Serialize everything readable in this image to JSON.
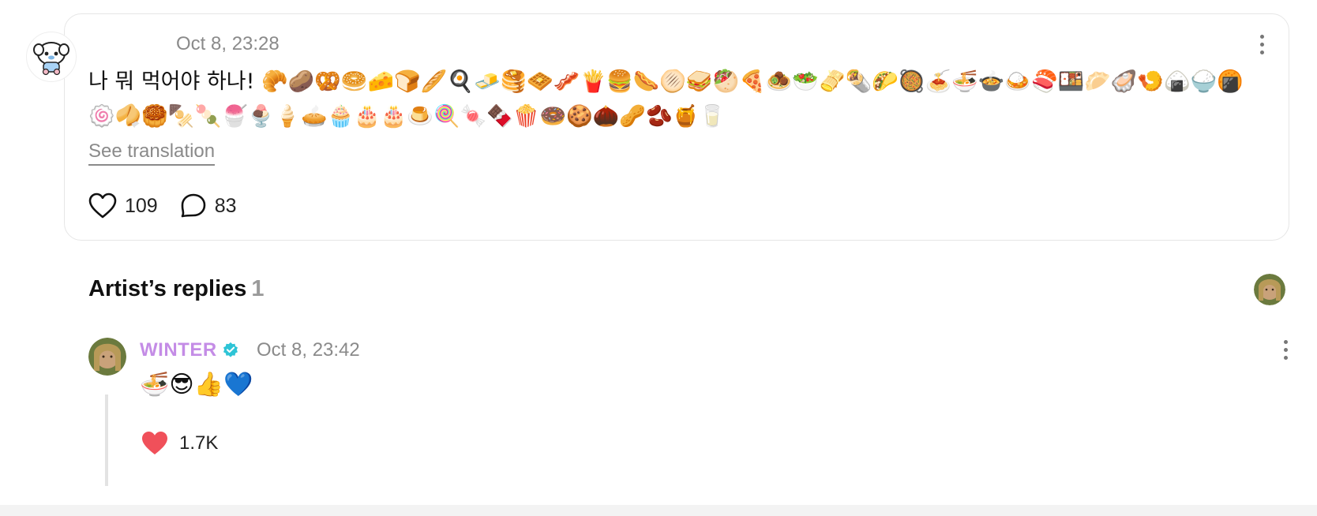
{
  "post": {
    "timestamp": "Oct 8, 23:28",
    "text": "나 뭐 먹어야 하나! 🥐🥔🥨🥯🧀🍞🥖🍳🧈🥞🧇🥓🍟🍔🌭🫓🥪🥙🍕🧆🥗🫔🌯🌮🥘🍝🍜🍲🍛🍣🍱🥟🦪🍤🍙🍚🍘🍥🥠🥮🍢🍡🍧🍨🍦🥧🧁🎂🎂🍮🍭🍬🍫🍿🍩🍪🌰🥜🫘🍯🥛",
    "see_translation": "See translation",
    "likes": "109",
    "comments": "83"
  },
  "artist_replies": {
    "title": "Artist’s replies",
    "count": "1"
  },
  "reply": {
    "author": "WINTER",
    "timestamp": "Oct 8, 23:42",
    "text": "🍜😎👍💙",
    "likes": "1.7K"
  },
  "colors": {
    "artist_name": "#c48ce6",
    "verified": "#2ec4d6",
    "like_heart": "#f0505a",
    "muted_text": "#8a8a8a"
  },
  "icons": {
    "heart": "heart-outline-icon",
    "comment": "comment-bubble-icon",
    "more": "more-vertical-icon",
    "verified": "verified-badge-icon",
    "liked_heart": "heart-filled-icon"
  }
}
